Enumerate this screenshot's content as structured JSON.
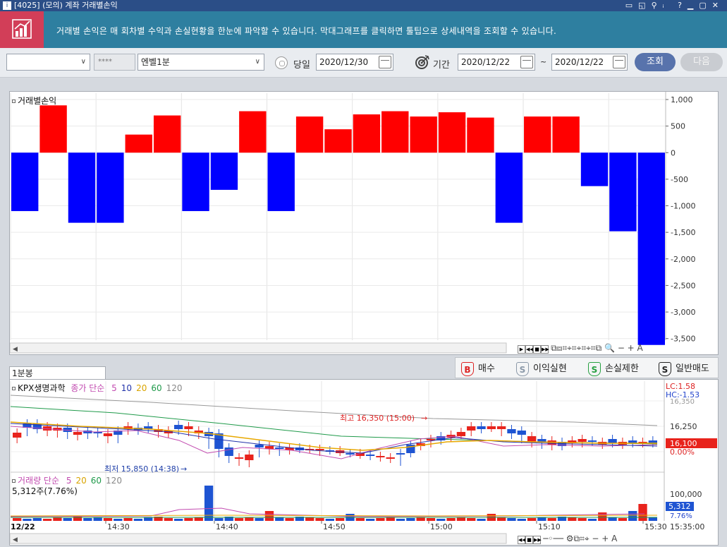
{
  "window": {
    "title": "[4025] (모의) 계좌 거래별손익"
  },
  "info": {
    "text": "거래별 손익은 매 회차별 수익과 손실현황을 한눈에 파악할 수 있습니다. 막대그래프를 클릭하면 툴팁으로 상세내역을 조회할 수 있습니다."
  },
  "toolbar": {
    "account_select": "",
    "password": "****",
    "product_select": "엔벨1분",
    "today_label": "당일",
    "today_date": "2020/12/30",
    "period_label": "기간",
    "from_date": "2020/12/22",
    "tilde": "~",
    "to_date": "2020/12/22",
    "search_label": "조회",
    "next_label": "다음"
  },
  "pnl_panel": {
    "title": "거래별손익"
  },
  "legend": {
    "buy": "매수",
    "profit_realize": "이익실현",
    "stop_loss": "손실제한",
    "general_sell": "일반매도",
    "buy_icon": "B",
    "sell_icon": "S"
  },
  "bottom_tab": {
    "label": "1분봉"
  },
  "price_legend": {
    "stock": "KPX생명과학",
    "ma_label": "종가 단순",
    "periods": [
      "5",
      "10",
      "20",
      "60",
      "120"
    ],
    "colors": [
      "#c24bb0",
      "#2233aa",
      "#d9a400",
      "#1f9a4a",
      "#888888"
    ]
  },
  "price_annotations": {
    "high": "최고 16,350 (15:00)",
    "low": "최저 15,850 (14:38)",
    "lc": "LC:1.58",
    "hc": "HC:-1.53",
    "last_price": "16,100",
    "last_pct": "0.00%",
    "tick_16250": "16,250",
    "tick_top": "16,350"
  },
  "volume_legend": {
    "label": "거래량 단순",
    "periods": [
      "5",
      "20",
      "60",
      "120"
    ],
    "total": "5,312주(7.76%)",
    "tick": "100,000",
    "last": "5,312",
    "last_pct": "7.76%"
  },
  "time_axis": {
    "date": "12/22",
    "ticks": [
      "14:30",
      "14:40",
      "14:50",
      "15:00",
      "15:10",
      "15:30"
    ],
    "end": "15:35:00"
  },
  "chart_data": [
    {
      "type": "bar",
      "title": "거래별손익",
      "ylim": [
        -3650,
        1000
      ],
      "yticks": [
        1000,
        500,
        0,
        -500,
        -1000,
        -1500,
        -2000,
        -2500,
        -3000,
        -3500
      ],
      "ytick_labels": [
        "1,000",
        "500",
        "0",
        "-500",
        "-1,000",
        "-1,500",
        "-2,000",
        "-2,500",
        "-3,000",
        "-3,500"
      ],
      "values": [
        -1100,
        890,
        -1320,
        -1320,
        340,
        700,
        -1100,
        -700,
        780,
        -1100,
        680,
        440,
        720,
        780,
        680,
        760,
        660,
        -1320,
        680,
        680,
        -630,
        -1480,
        -3620
      ],
      "colors": {
        "positive": "#ff0000",
        "negative": "#0000ff"
      }
    }
  ]
}
